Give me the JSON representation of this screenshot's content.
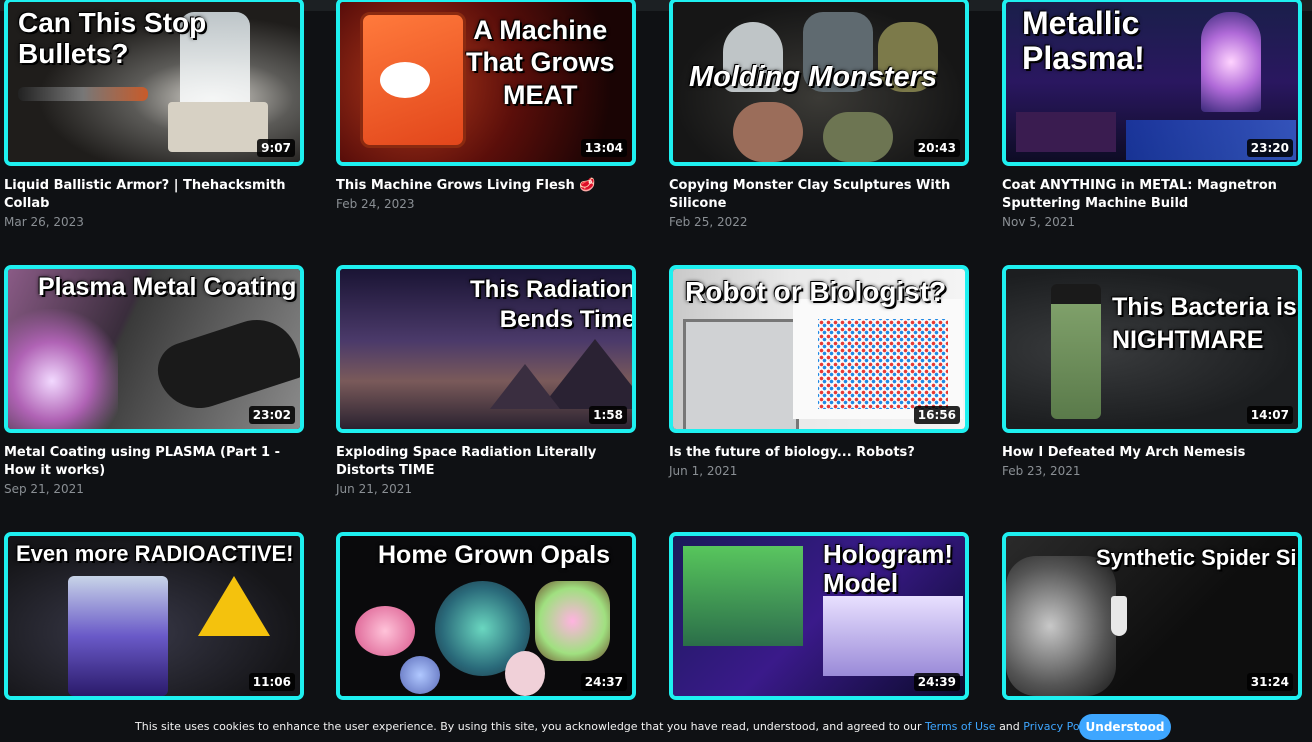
{
  "videos": [
    {
      "overlay": "Can This Stop\nBullets?",
      "duration": "9:07",
      "title": "Liquid Ballistic Armor? | Thehacksmith Collab",
      "date": "Mar 26, 2023"
    },
    {
      "overlay": "A Machine\nThat Grows\nMEAT",
      "duration": "13:04",
      "title": "This Machine Grows Living Flesh 🥩",
      "date": "Feb 24, 2023"
    },
    {
      "overlay": "Molding Monsters",
      "duration": "20:43",
      "title": "Copying Monster Clay Sculptures With Silicone",
      "date": "Feb 25, 2022"
    },
    {
      "overlay": "Metallic\nPlasma!",
      "duration": "23:20",
      "title": "Coat ANYTHING in METAL: Magnetron Sputtering Machine Build",
      "date": "Nov 5, 2021"
    },
    {
      "overlay": "Plasma Metal Coating",
      "duration": "23:02",
      "title": "Metal Coating using PLASMA (Part 1 - How it works)",
      "date": "Sep 21, 2021"
    },
    {
      "overlay": "This Radiation\nBends Time",
      "duration": "1:58",
      "title": "Exploding Space Radiation Literally Distorts TIME",
      "date": "Jun 21, 2021"
    },
    {
      "overlay": "Robot or Biologist?",
      "duration": "16:56",
      "title": "Is the future of biology... Robots?",
      "date": "Jun 1, 2021"
    },
    {
      "overlay": "This Bacteria is a\nNIGHTMARE",
      "duration": "14:07",
      "title": "How I Defeated My Arch Nemesis",
      "date": "Feb 23, 2021"
    },
    {
      "overlay": "Even more RADIOACTIVE!",
      "duration": "11:06",
      "title": "",
      "date": ""
    },
    {
      "overlay": "Home Grown Opals",
      "duration": "24:37",
      "title": "",
      "date": ""
    },
    {
      "overlay": "Hologram!\nModel",
      "duration": "24:39",
      "title": "",
      "date": ""
    },
    {
      "overlay": "Synthetic Spider Silk",
      "duration": "31:24",
      "title": "",
      "date": ""
    }
  ],
  "cookie": {
    "text_before": "This site uses cookies to enhance the user experience. By using this site, you acknowledge that you have read, understood, and agreed to our",
    "terms_link": "Terms of Use",
    "and": "and",
    "privacy_link": "Privacy Policy",
    "period": ".",
    "button": "Understood"
  },
  "colors": {
    "thumb_border": "#1ef0f0",
    "accent": "#3ea6ff",
    "background": "#0f1114"
  }
}
